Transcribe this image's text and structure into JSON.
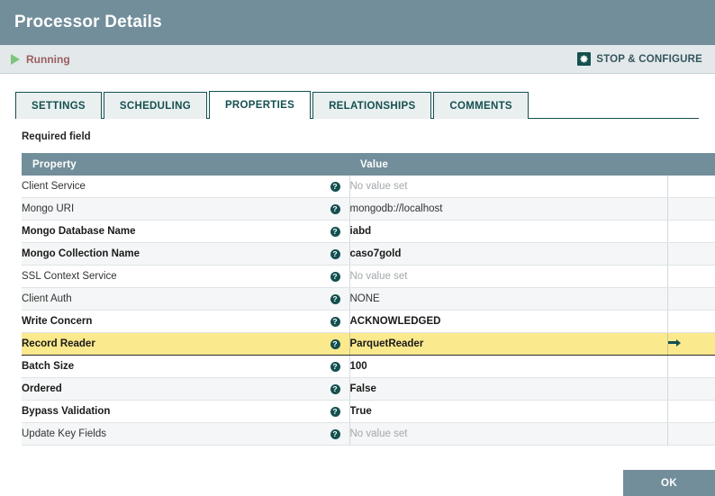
{
  "window": {
    "title": "Processor Details"
  },
  "status": {
    "icon": "play-icon",
    "state": "Running",
    "action_icon": "gear-icon",
    "action_label": "STOP & CONFIGURE"
  },
  "tabs": [
    {
      "label": "SETTINGS",
      "active": false
    },
    {
      "label": "SCHEDULING",
      "active": false
    },
    {
      "label": "PROPERTIES",
      "active": true
    },
    {
      "label": "RELATIONSHIPS",
      "active": false
    },
    {
      "label": "COMMENTS",
      "active": false
    }
  ],
  "main": {
    "required_note": "Required field",
    "columns": {
      "property": "Property",
      "value": "Value",
      "action": ""
    },
    "rows": [
      {
        "property": "Client Service",
        "required": false,
        "value": "No value set",
        "empty": true,
        "highlight": false,
        "action": ""
      },
      {
        "property": "Mongo URI",
        "required": false,
        "value": "mongodb://localhost",
        "empty": false,
        "highlight": false,
        "action": ""
      },
      {
        "property": "Mongo Database Name",
        "required": true,
        "value": "iabd",
        "empty": false,
        "highlight": false,
        "action": ""
      },
      {
        "property": "Mongo Collection Name",
        "required": true,
        "value": "caso7gold",
        "empty": false,
        "highlight": false,
        "action": ""
      },
      {
        "property": "SSL Context Service",
        "required": false,
        "value": "No value set",
        "empty": true,
        "highlight": false,
        "action": ""
      },
      {
        "property": "Client Auth",
        "required": false,
        "value": "NONE",
        "empty": false,
        "highlight": false,
        "action": ""
      },
      {
        "property": "Write Concern",
        "required": true,
        "value": "ACKNOWLEDGED",
        "empty": false,
        "highlight": false,
        "action": ""
      },
      {
        "property": "Record Reader",
        "required": true,
        "value": "ParquetReader",
        "empty": false,
        "highlight": true,
        "action": "go-to-arrow-icon"
      },
      {
        "property": "Batch Size",
        "required": true,
        "value": "100",
        "empty": false,
        "highlight": false,
        "action": ""
      },
      {
        "property": "Ordered",
        "required": true,
        "value": "False",
        "empty": false,
        "highlight": false,
        "action": ""
      },
      {
        "property": "Bypass Validation",
        "required": true,
        "value": "True",
        "empty": false,
        "highlight": false,
        "action": ""
      },
      {
        "property": "Update Key Fields",
        "required": false,
        "value": "No value set",
        "empty": true,
        "highlight": false,
        "action": ""
      }
    ],
    "help_glyph": "?"
  },
  "footer": {
    "ok_label": "OK"
  },
  "colors": {
    "header_bar": "#728e9b",
    "accent_teal": "#14504f",
    "status_bar": "#e3e8ea",
    "running_text": "#9b5f5f",
    "running_icon": "#7dc57d",
    "highlight_row": "#fbe98d",
    "row_alt": "#f4f6f7"
  }
}
